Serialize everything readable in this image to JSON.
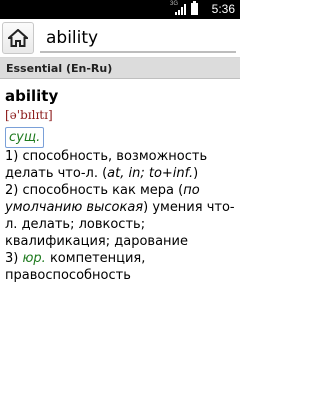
{
  "status_bar": {
    "network": "3G",
    "time": "5:36",
    "battery_level": 1.0
  },
  "search": {
    "value": "ability"
  },
  "dictionary": {
    "name": "Essential (En-Ru)"
  },
  "entry": {
    "headword": "ability",
    "transcription": "[ə'bɪlɪtɪ]",
    "pos": "сущ.",
    "senses": [
      {
        "num": "1)",
        "text": "способность, возможность делать что-л. (",
        "note": "at, in; to+inf.",
        "tail": ")"
      },
      {
        "num": "2)",
        "text": "способность как мера (",
        "note": "по умолчанию высокая",
        "tail": ") умения что-л. делать; ловкость; квалификация; дарование"
      },
      {
        "num": "3)",
        "label": "юр.",
        "text": "компетенция, правоспособность"
      }
    ]
  },
  "colors": {
    "transcription": "#8b1a1a",
    "label_green": "#1f7a1f",
    "header_bg": "#dcdcdc"
  }
}
